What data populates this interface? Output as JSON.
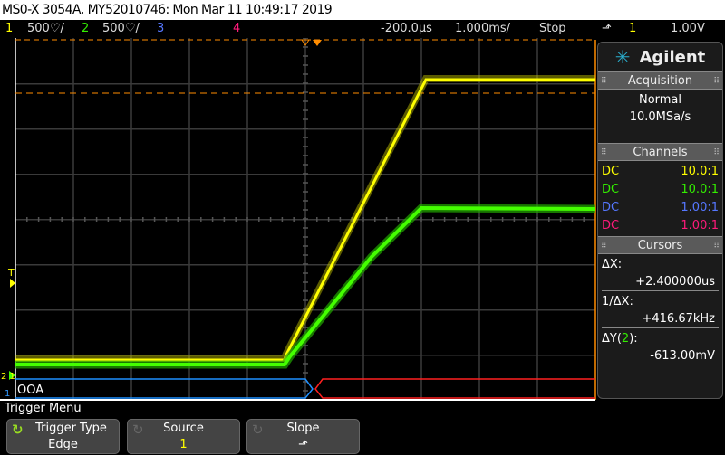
{
  "title": "MS0-X 3054A, MY52010746: Mon Mar 11 10:49:17 2019",
  "status": {
    "ch1": "1",
    "ch1_scale": "500♡/",
    "ch2": "2",
    "ch2_scale": "500♡/",
    "ch3": "3",
    "ch4": "4",
    "delay": "-200.0µs",
    "timebase": "1.000ms/",
    "run_state": "Stop",
    "trigger_slope_icon": "rising-edge-icon",
    "trigger_source": "1",
    "trigger_level": "1.00V"
  },
  "colors": {
    "ch1": "#ffff00",
    "ch2": "#33ee00",
    "ch3": "#5577ff",
    "ch4": "#ff1a7a",
    "orange": "#ff8c00"
  },
  "plot": {
    "trigger_marker": "T",
    "ground_labels": "2 1",
    "bus_label": "OOA",
    "bus_index": "1"
  },
  "side": {
    "brand": "Agilent",
    "acquisition": {
      "header": "Acquisition",
      "mode": "Normal",
      "rate": "10.0MSa/s"
    },
    "channels": {
      "header": "Channels",
      "rows": [
        {
          "coupling": "DC",
          "probe": "10.0:1"
        },
        {
          "coupling": "DC",
          "probe": "10.0:1"
        },
        {
          "coupling": "DC",
          "probe": "1.00:1"
        },
        {
          "coupling": "DC",
          "probe": "1.00:1"
        }
      ]
    },
    "cursors": {
      "header": "Cursors",
      "dx_label": "ΔX:",
      "dx": "+2.400000us",
      "inv_label": "1/ΔX:",
      "inv": "+416.67kHz",
      "dy_label": "ΔY(",
      "dy_ch": "2",
      "dy_end": "):",
      "dy": "-613.00mV"
    }
  },
  "menu": {
    "title": "Trigger Menu",
    "keys": [
      {
        "label": "Trigger Type",
        "value": "Edge"
      },
      {
        "label": "Source",
        "value": "1"
      },
      {
        "label": "Slope",
        "value": "⬏"
      }
    ]
  }
}
